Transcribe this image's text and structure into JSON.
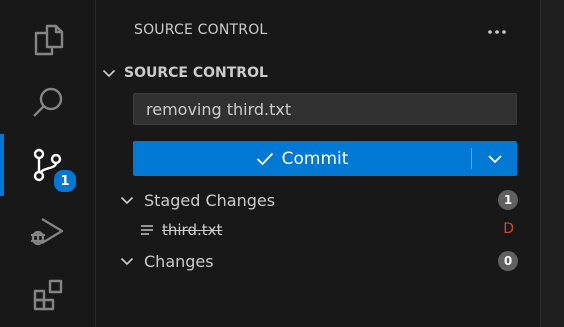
{
  "activity_bar": {
    "items": [
      {
        "icon": "files-icon"
      },
      {
        "icon": "search-icon"
      },
      {
        "icon": "source-control-icon",
        "badge": "1",
        "active": true
      },
      {
        "icon": "run-debug-icon"
      },
      {
        "icon": "extensions-icon"
      }
    ],
    "accent_color": "#0078d4"
  },
  "sidebar": {
    "view_title": "SOURCE CONTROL",
    "more_icon": "ellipsis-icon",
    "section_title": "SOURCE CONTROL",
    "commit_message": "removing third.txt",
    "commit_button_label": "Commit",
    "groups": [
      {
        "label": "Staged Changes",
        "count": "1",
        "files": [
          {
            "name": "third.txt",
            "status": "D",
            "status_color": "#c74e39"
          }
        ]
      },
      {
        "label": "Changes",
        "count": "0",
        "files": []
      }
    ]
  }
}
